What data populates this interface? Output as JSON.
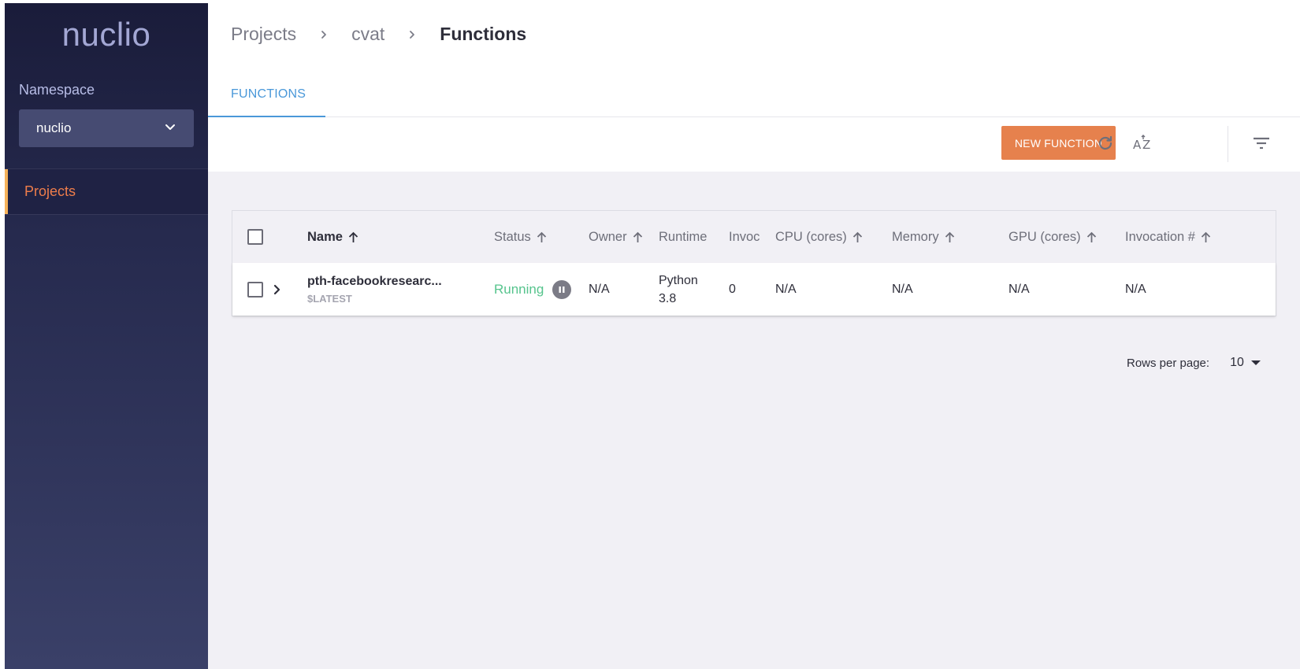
{
  "app": {
    "logo": "nuclio"
  },
  "sidebar": {
    "namespace_label": "Namespace",
    "namespace_value": "nuclio",
    "items": [
      {
        "label": "Projects",
        "active": true
      }
    ]
  },
  "breadcrumb": {
    "items": [
      "Projects",
      "cvat"
    ],
    "current": "Functions"
  },
  "tabs": [
    {
      "label": "FUNCTIONS",
      "active": true
    }
  ],
  "toolbar": {
    "new_function_label": "NEW FUNCTION",
    "icons": [
      "refresh-icon",
      "sort-az-icon",
      "filter-icon"
    ]
  },
  "table": {
    "headers": {
      "name": "Name",
      "status": "Status",
      "owner": "Owner",
      "runtime": "Runtime",
      "invoc": "Invoc",
      "cpu": "CPU (cores)",
      "memory": "Memory",
      "gpu": "GPU (cores)",
      "invocation": "Invocation #"
    },
    "rows": [
      {
        "name": "pth-facebookresearc...",
        "version": "$LATEST",
        "status": "Running",
        "owner": "N/A",
        "runtime_line1": "Python",
        "runtime_line2": "3.8",
        "invoc": "0",
        "cpu": "N/A",
        "memory": "N/A",
        "gpu": "N/A",
        "invocation": "N/A"
      }
    ]
  },
  "pagination": {
    "rows_per_page_label": "Rows per page:",
    "rows_per_page_value": "10"
  },
  "colors": {
    "accent": "#e6814d",
    "tab_active": "#4a98d9",
    "status_running": "#56c48d",
    "nav_active_text": "#ee7d4b"
  }
}
